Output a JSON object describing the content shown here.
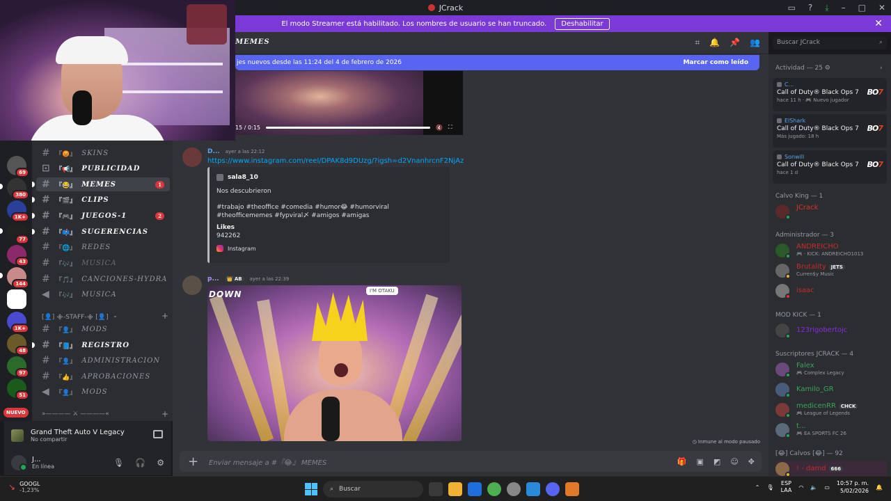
{
  "window": {
    "title": "JCrack"
  },
  "banner": {
    "text": "El modo Streamer está habilitado. Los nombres de usuario se han truncado.",
    "button": "Deshabilitar"
  },
  "servers": [
    {
      "badge": "69"
    },
    {
      "badge": "380"
    },
    {
      "badge": "1K+"
    },
    {
      "badge": "77"
    },
    {
      "badge": "43"
    },
    {
      "badge": "144"
    },
    {
      "badge": ""
    },
    {
      "badge": "1K+"
    },
    {
      "badge": "48"
    },
    {
      "badge": "97"
    },
    {
      "badge": "51"
    }
  ],
  "nuevo_label": "NUEVO",
  "channels": [
    {
      "emoji": "『😡』",
      "name": "SKINS",
      "style": "normal"
    },
    {
      "emoji": "『📢』",
      "name": "PUBLICIDAD",
      "style": "bold"
    },
    {
      "emoji": "『😂』",
      "name": "MEMES",
      "style": "active",
      "count": "1"
    },
    {
      "emoji": "『🎬』",
      "name": "CLIPS",
      "style": "bold"
    },
    {
      "emoji": "『🎮』",
      "name": "JUEGOS-1",
      "style": "bold",
      "count": "2"
    },
    {
      "emoji": "『📫』",
      "name": "SUGERENCIAS",
      "style": "bold"
    },
    {
      "emoji": "『🌐』",
      "name": "REDES",
      "style": "normal"
    },
    {
      "emoji": "『🎶』",
      "name": "MUSICA",
      "style": "muted"
    },
    {
      "emoji": "『🎵』",
      "name": "CANCIONES-HYDRA",
      "style": "normal"
    },
    {
      "emoji": "『🎶』",
      "name": "MUSICA",
      "style": "normal"
    }
  ],
  "category_staff": "[👤] ᯽-STAFF-᯽ [👤]",
  "channels_staff": [
    {
      "emoji": "『👤』",
      "name": "MODS",
      "style": "normal"
    },
    {
      "emoji": "『📘』",
      "name": "REGISTRO",
      "style": "bold"
    },
    {
      "emoji": "『👤』",
      "name": "ADMINISTRACION",
      "style": "normal"
    },
    {
      "emoji": "『👍』",
      "name": "APROBACIONES",
      "style": "normal"
    },
    {
      "emoji": "『👤』",
      "name": "MODS",
      "style": "normal"
    }
  ],
  "category_more": "»————  ⚔  ————«",
  "activity": {
    "game": "Grand Theft Auto V Legacy",
    "status": "No compartir"
  },
  "user": {
    "name": "J...",
    "status": "En línea"
  },
  "chat": {
    "channel": "MEMES",
    "new_messages": "jes nuevos desde las 11:24 del 4 de febrero de 2026",
    "mark_read": "Marcar como leído",
    "video_time": "15 / 0:15",
    "msg1": {
      "author": "D...",
      "time": "ayer a las 22:12",
      "link": "https://www.instagram.com/reel/DPAK8d9DUzg/?igsh=d2VnanhrcnF2NjAz",
      "embed_author": "sala8_10",
      "embed_title": "Nos descubrieron",
      "embed_desc": "#trabajo #theoffice #comedia #humor😂 #humorviral #theofficememes #fypviral〆 #amigos #amigas",
      "field_name": "Likes",
      "field_value": "942262",
      "source": "Instagram"
    },
    "msg2": {
      "author": "p...",
      "tag": "👑 AB",
      "time": "ayer a las 22:39"
    },
    "image_text_down": "DOWN",
    "image_text_otaku": "I'M OTAKU",
    "immune": "Inmune al modo pausado",
    "composer_placeholder": "Enviar mensaje a #『😂』 MEMES"
  },
  "search_placeholder": "Buscar JCrack",
  "side": {
    "activity_header": "Actividad — 25",
    "cards": [
      {
        "user": "C...",
        "game": "Call of Duty® Black Ops 7",
        "status": "hace 11 h · 🎮 Nuevo jugador"
      },
      {
        "user": "ElShark",
        "game": "Call of Duty® Black Ops 7",
        "status": "Más jugado: 18 h"
      },
      {
        "user": "Sonwill",
        "game": "Call of Duty® Black Ops 7",
        "status": "hace 1 d"
      }
    ],
    "bo7_a": "BO",
    "bo7_b": "7",
    "groups": [
      {
        "title": "Calvo King — 1",
        "members": [
          {
            "name": "JCrack",
            "color": "#e0302a",
            "sub": ""
          }
        ]
      },
      {
        "title": "Administrador — 3",
        "members": [
          {
            "name": "ANDREICHO",
            "color": "#c72c2c",
            "sub": "🎮 · KICK: ANDREICHO1013"
          },
          {
            "name": "Brutality",
            "color": "#c72c2c",
            "chip": "JETS",
            "sub": "Curren$y Music"
          },
          {
            "name": "isaac",
            "color": "#c72c2c",
            "sub": ""
          }
        ]
      },
      {
        "title": "MOD KICK — 1",
        "members": [
          {
            "name": "123rigobertojc",
            "color": "#8a2be2",
            "sub": ""
          }
        ]
      },
      {
        "title": "Suscriptores JCRACK — 4",
        "members": [
          {
            "name": "Falex",
            "color": "#3ba55c",
            "sub": "🎮 Complex Legacy"
          },
          {
            "name": "Kamilo_GR",
            "color": "#3ba55c",
            "sub": ""
          },
          {
            "name": "medicenRR",
            "color": "#3ba55c",
            "chip": "CHCK",
            "sub": "🎮 League of Legends"
          },
          {
            "name": "t...",
            "color": "#3ba55c",
            "sub": "🎮 EA SPORTS FC 26"
          }
        ]
      },
      {
        "title": "[😂] Calvos [😂] — 92",
        "members": [
          {
            "name": "! - damd",
            "color": "#c72c2c",
            "chip": "666",
            "sub": ""
          }
        ]
      }
    ]
  },
  "taskbar": {
    "stock_name": "GOOGL",
    "stock_value": "-1,23%",
    "search": "Buscar",
    "lang1": "ESP",
    "lang2": "LAA",
    "time": "10:57 p. m.",
    "date": "5/02/2026"
  }
}
